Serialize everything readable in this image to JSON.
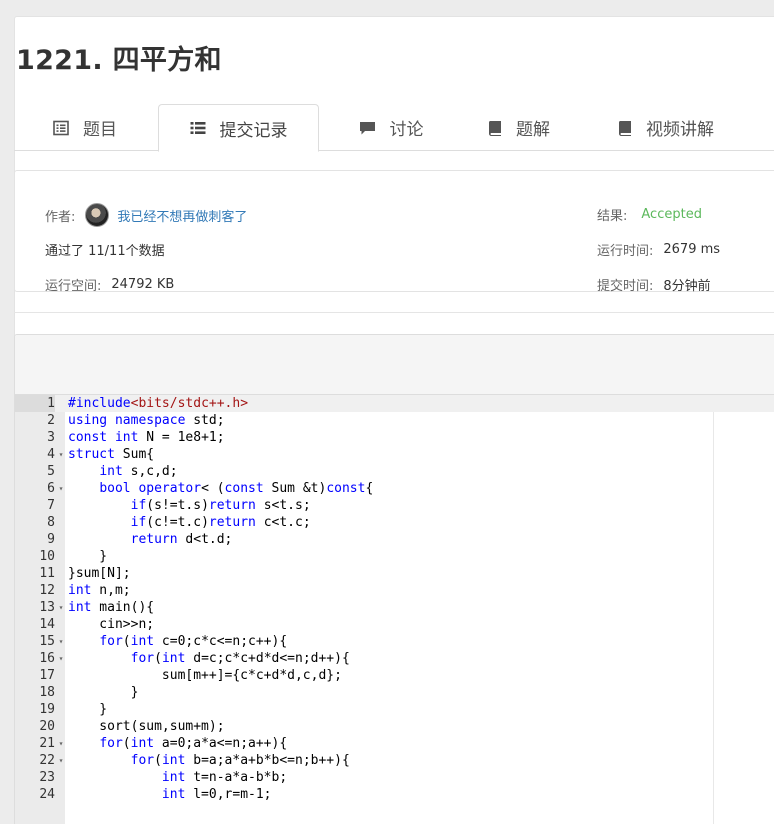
{
  "problem": {
    "title": "1221. 四平方和"
  },
  "tabs": [
    {
      "label": "题目",
      "icon": "list-alt-icon"
    },
    {
      "label": "提交记录",
      "icon": "list-icon",
      "active": true
    },
    {
      "label": "讨论",
      "icon": "comment-icon"
    },
    {
      "label": "题解",
      "icon": "book-icon"
    },
    {
      "label": "视频讲解",
      "icon": "book-icon"
    }
  ],
  "submission": {
    "author_label": "作者:",
    "author_name": "我已经不想再做刺客了",
    "result_label": "结果:",
    "result_value": "Accepted",
    "passed_text": "通过了 11/11个数据",
    "runtime_label": "运行时间:",
    "runtime_value": "2679 ms",
    "memory_label": "运行空间:",
    "memory_value": "24792 KB",
    "submit_time_label": "提交时间:",
    "submit_time_value": "8分钟前"
  },
  "colors": {
    "accepted": "#5cb85c",
    "link": "#337ab7",
    "keyword": "#0000ff",
    "string": "#a31515"
  },
  "code": {
    "lines": [
      {
        "n": "1",
        "fold": false,
        "tokens": [
          [
            "kw",
            "#include"
          ],
          [
            "str",
            "<bits/stdc++.h>"
          ]
        ]
      },
      {
        "n": "2",
        "fold": false,
        "tokens": [
          [
            "kw",
            "using namespace"
          ],
          [
            "",
            " std;"
          ]
        ]
      },
      {
        "n": "3",
        "fold": false,
        "tokens": [
          [
            "kw",
            "const int"
          ],
          [
            "",
            " N = 1e8+1;"
          ]
        ]
      },
      {
        "n": "4",
        "fold": true,
        "tokens": [
          [
            "kw",
            "struct"
          ],
          [
            "",
            " Sum{"
          ]
        ]
      },
      {
        "n": "5",
        "fold": false,
        "tokens": [
          [
            "",
            "    "
          ],
          [
            "kw",
            "int"
          ],
          [
            "",
            " s,c,d;"
          ]
        ]
      },
      {
        "n": "6",
        "fold": true,
        "tokens": [
          [
            "",
            "    "
          ],
          [
            "kw",
            "bool operator"
          ],
          [
            "",
            "< ("
          ],
          [
            "kw",
            "const"
          ],
          [
            "",
            " Sum &t)"
          ],
          [
            "kw",
            "const"
          ],
          [
            "",
            "{"
          ]
        ]
      },
      {
        "n": "7",
        "fold": false,
        "tokens": [
          [
            "",
            "        "
          ],
          [
            "kw",
            "if"
          ],
          [
            "",
            "(s!=t.s)"
          ],
          [
            "kw",
            "return"
          ],
          [
            "",
            " s<t.s;"
          ]
        ]
      },
      {
        "n": "8",
        "fold": false,
        "tokens": [
          [
            "",
            "        "
          ],
          [
            "kw",
            "if"
          ],
          [
            "",
            "(c!=t.c)"
          ],
          [
            "kw",
            "return"
          ],
          [
            "",
            " c<t.c;"
          ]
        ]
      },
      {
        "n": "9",
        "fold": false,
        "tokens": [
          [
            "",
            "        "
          ],
          [
            "kw",
            "return"
          ],
          [
            "",
            " d<t.d;"
          ]
        ]
      },
      {
        "n": "10",
        "fold": false,
        "tokens": [
          [
            "",
            "    }"
          ]
        ]
      },
      {
        "n": "11",
        "fold": false,
        "tokens": [
          [
            "",
            "}sum[N];"
          ]
        ]
      },
      {
        "n": "12",
        "fold": false,
        "tokens": [
          [
            "kw",
            "int"
          ],
          [
            "",
            " n,m;"
          ]
        ]
      },
      {
        "n": "13",
        "fold": true,
        "tokens": [
          [
            "kw",
            "int"
          ],
          [
            "",
            " main(){"
          ]
        ]
      },
      {
        "n": "14",
        "fold": false,
        "tokens": [
          [
            "",
            "    cin>>n;"
          ]
        ]
      },
      {
        "n": "15",
        "fold": true,
        "tokens": [
          [
            "",
            "    "
          ],
          [
            "kw",
            "for"
          ],
          [
            "",
            "("
          ],
          [
            "kw",
            "int"
          ],
          [
            "",
            " c=0;c*c<=n;c++){"
          ]
        ]
      },
      {
        "n": "16",
        "fold": true,
        "tokens": [
          [
            "",
            "        "
          ],
          [
            "kw",
            "for"
          ],
          [
            "",
            "("
          ],
          [
            "kw",
            "int"
          ],
          [
            "",
            " d=c;c*c+d*d<=n;d++){"
          ]
        ]
      },
      {
        "n": "17",
        "fold": false,
        "tokens": [
          [
            "",
            "            sum[m++]={c*c+d*d,c,d};"
          ]
        ]
      },
      {
        "n": "18",
        "fold": false,
        "tokens": [
          [
            "",
            "        }"
          ]
        ]
      },
      {
        "n": "19",
        "fold": false,
        "tokens": [
          [
            "",
            "    }"
          ]
        ]
      },
      {
        "n": "20",
        "fold": false,
        "tokens": [
          [
            "",
            "    sort(sum,sum+m);"
          ]
        ]
      },
      {
        "n": "21",
        "fold": true,
        "tokens": [
          [
            "",
            "    "
          ],
          [
            "kw",
            "for"
          ],
          [
            "",
            "("
          ],
          [
            "kw",
            "int"
          ],
          [
            "",
            " a=0;a*a<=n;a++){"
          ]
        ]
      },
      {
        "n": "22",
        "fold": true,
        "tokens": [
          [
            "",
            "        "
          ],
          [
            "kw",
            "for"
          ],
          [
            "",
            "("
          ],
          [
            "kw",
            "int"
          ],
          [
            "",
            " b=a;a*a+b*b<=n;b++){"
          ]
        ]
      },
      {
        "n": "23",
        "fold": false,
        "tokens": [
          [
            "",
            "            "
          ],
          [
            "kw",
            "int"
          ],
          [
            "",
            " t=n-a*a-b*b;"
          ]
        ]
      },
      {
        "n": "24",
        "fold": false,
        "tokens": [
          [
            "",
            "            "
          ],
          [
            "kw",
            "int"
          ],
          [
            "",
            " l=0,r=m-1;"
          ]
        ]
      }
    ]
  }
}
